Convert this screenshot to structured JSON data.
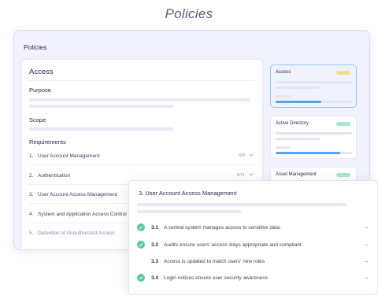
{
  "page_heading": "Policies",
  "window": {
    "title": "Policies"
  },
  "main": {
    "title": "Access",
    "purpose_label": "Purpose",
    "scope_label": "Scope",
    "requirements_label": "Requirements",
    "requirements": [
      {
        "number": "1.",
        "label": "User Account Management",
        "count": "6/6"
      },
      {
        "number": "2.",
        "label": "Authentication",
        "count": "5/11"
      },
      {
        "number": "3.",
        "label": "User Account Access Management",
        "count": ""
      },
      {
        "number": "4.",
        "label": "System and Application Access Control",
        "count": ""
      },
      {
        "number": "5.",
        "label": "Detection of Unauthorized Access",
        "count": ""
      }
    ]
  },
  "side_cards": [
    {
      "title": "Access",
      "badge_color": "#f6dc8a",
      "progress": 0.6,
      "active": true
    },
    {
      "title": "Active Directory",
      "badge_color": "#a7e6cd",
      "progress": 0.85,
      "active": false
    },
    {
      "title": "Asset Management",
      "badge_color": "#a7e6cd",
      "active": false
    }
  ],
  "popover": {
    "title": "3. User Account Access Management",
    "items": [
      {
        "number": "3.1",
        "text": "A central system manages access to sensitive data.",
        "done": true
      },
      {
        "number": "3.2",
        "text": "Audits ensure users' access stays appropriate and compliant.",
        "done": true
      },
      {
        "number": "3.3",
        "text": "Access is updated to match users' new roles",
        "done": false
      },
      {
        "number": "3.4",
        "text": "Login notices ensure user security awareness",
        "done": true
      }
    ]
  },
  "colors": {
    "accent": "#5aa3ea",
    "check": "#58c9a2"
  },
  "icons": {
    "chevron": "chevron-down-icon",
    "arrow": "arrow-right-icon",
    "check": "check-circle-icon"
  }
}
